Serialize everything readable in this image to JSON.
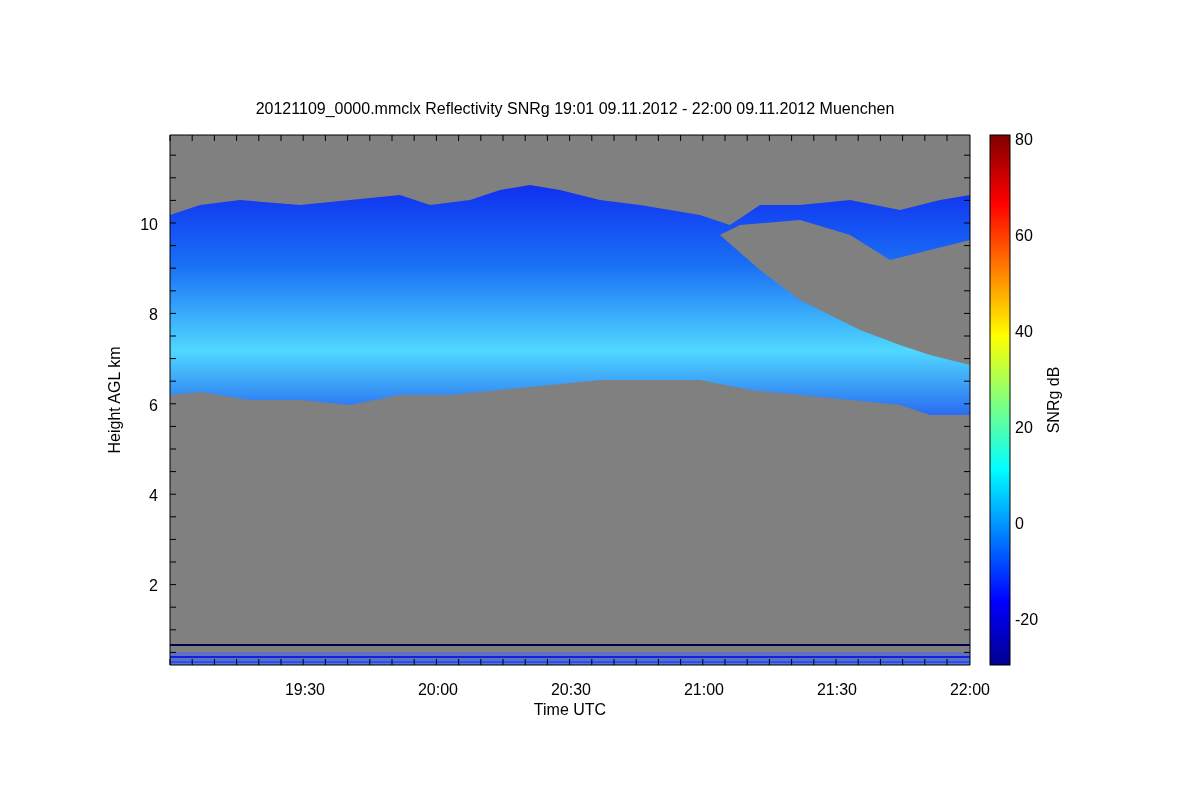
{
  "title": "20121109_0000.mmclx Reflectivity SNRg   19:01 09.11.2012 - 22:00 09.11.2012 Muenchen",
  "y_axis": {
    "label": "Height AGL km",
    "ticks": [
      "10",
      "8",
      "6",
      "4",
      "2"
    ]
  },
  "x_axis": {
    "label": "Time UTC",
    "ticks": [
      "19:30",
      "20:00",
      "20:30",
      "21:00",
      "21:30",
      "22:00"
    ]
  },
  "colorbar": {
    "label": "SNRg dB",
    "ticks": [
      "80",
      "60",
      "40",
      "20",
      "0",
      "-20"
    ]
  }
}
